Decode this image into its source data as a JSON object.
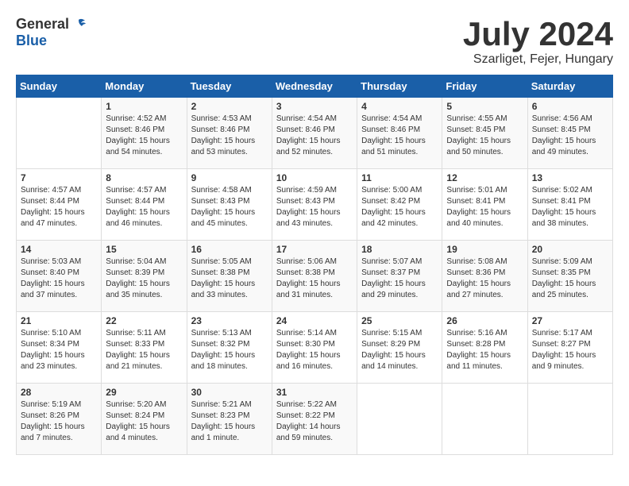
{
  "logo": {
    "general": "General",
    "blue": "Blue"
  },
  "title": {
    "month_year": "July 2024",
    "location": "Szarliget, Fejer, Hungary"
  },
  "days_of_week": [
    "Sunday",
    "Monday",
    "Tuesday",
    "Wednesday",
    "Thursday",
    "Friday",
    "Saturday"
  ],
  "weeks": [
    [
      {
        "day": "",
        "info": ""
      },
      {
        "day": "1",
        "info": "Sunrise: 4:52 AM\nSunset: 8:46 PM\nDaylight: 15 hours\nand 54 minutes."
      },
      {
        "day": "2",
        "info": "Sunrise: 4:53 AM\nSunset: 8:46 PM\nDaylight: 15 hours\nand 53 minutes."
      },
      {
        "day": "3",
        "info": "Sunrise: 4:54 AM\nSunset: 8:46 PM\nDaylight: 15 hours\nand 52 minutes."
      },
      {
        "day": "4",
        "info": "Sunrise: 4:54 AM\nSunset: 8:46 PM\nDaylight: 15 hours\nand 51 minutes."
      },
      {
        "day": "5",
        "info": "Sunrise: 4:55 AM\nSunset: 8:45 PM\nDaylight: 15 hours\nand 50 minutes."
      },
      {
        "day": "6",
        "info": "Sunrise: 4:56 AM\nSunset: 8:45 PM\nDaylight: 15 hours\nand 49 minutes."
      }
    ],
    [
      {
        "day": "7",
        "info": "Sunrise: 4:57 AM\nSunset: 8:44 PM\nDaylight: 15 hours\nand 47 minutes."
      },
      {
        "day": "8",
        "info": "Sunrise: 4:57 AM\nSunset: 8:44 PM\nDaylight: 15 hours\nand 46 minutes."
      },
      {
        "day": "9",
        "info": "Sunrise: 4:58 AM\nSunset: 8:43 PM\nDaylight: 15 hours\nand 45 minutes."
      },
      {
        "day": "10",
        "info": "Sunrise: 4:59 AM\nSunset: 8:43 PM\nDaylight: 15 hours\nand 43 minutes."
      },
      {
        "day": "11",
        "info": "Sunrise: 5:00 AM\nSunset: 8:42 PM\nDaylight: 15 hours\nand 42 minutes."
      },
      {
        "day": "12",
        "info": "Sunrise: 5:01 AM\nSunset: 8:41 PM\nDaylight: 15 hours\nand 40 minutes."
      },
      {
        "day": "13",
        "info": "Sunrise: 5:02 AM\nSunset: 8:41 PM\nDaylight: 15 hours\nand 38 minutes."
      }
    ],
    [
      {
        "day": "14",
        "info": "Sunrise: 5:03 AM\nSunset: 8:40 PM\nDaylight: 15 hours\nand 37 minutes."
      },
      {
        "day": "15",
        "info": "Sunrise: 5:04 AM\nSunset: 8:39 PM\nDaylight: 15 hours\nand 35 minutes."
      },
      {
        "day": "16",
        "info": "Sunrise: 5:05 AM\nSunset: 8:38 PM\nDaylight: 15 hours\nand 33 minutes."
      },
      {
        "day": "17",
        "info": "Sunrise: 5:06 AM\nSunset: 8:38 PM\nDaylight: 15 hours\nand 31 minutes."
      },
      {
        "day": "18",
        "info": "Sunrise: 5:07 AM\nSunset: 8:37 PM\nDaylight: 15 hours\nand 29 minutes."
      },
      {
        "day": "19",
        "info": "Sunrise: 5:08 AM\nSunset: 8:36 PM\nDaylight: 15 hours\nand 27 minutes."
      },
      {
        "day": "20",
        "info": "Sunrise: 5:09 AM\nSunset: 8:35 PM\nDaylight: 15 hours\nand 25 minutes."
      }
    ],
    [
      {
        "day": "21",
        "info": "Sunrise: 5:10 AM\nSunset: 8:34 PM\nDaylight: 15 hours\nand 23 minutes."
      },
      {
        "day": "22",
        "info": "Sunrise: 5:11 AM\nSunset: 8:33 PM\nDaylight: 15 hours\nand 21 minutes."
      },
      {
        "day": "23",
        "info": "Sunrise: 5:13 AM\nSunset: 8:32 PM\nDaylight: 15 hours\nand 18 minutes."
      },
      {
        "day": "24",
        "info": "Sunrise: 5:14 AM\nSunset: 8:30 PM\nDaylight: 15 hours\nand 16 minutes."
      },
      {
        "day": "25",
        "info": "Sunrise: 5:15 AM\nSunset: 8:29 PM\nDaylight: 15 hours\nand 14 minutes."
      },
      {
        "day": "26",
        "info": "Sunrise: 5:16 AM\nSunset: 8:28 PM\nDaylight: 15 hours\nand 11 minutes."
      },
      {
        "day": "27",
        "info": "Sunrise: 5:17 AM\nSunset: 8:27 PM\nDaylight: 15 hours\nand 9 minutes."
      }
    ],
    [
      {
        "day": "28",
        "info": "Sunrise: 5:19 AM\nSunset: 8:26 PM\nDaylight: 15 hours\nand 7 minutes."
      },
      {
        "day": "29",
        "info": "Sunrise: 5:20 AM\nSunset: 8:24 PM\nDaylight: 15 hours\nand 4 minutes."
      },
      {
        "day": "30",
        "info": "Sunrise: 5:21 AM\nSunset: 8:23 PM\nDaylight: 15 hours\nand 1 minute."
      },
      {
        "day": "31",
        "info": "Sunrise: 5:22 AM\nSunset: 8:22 PM\nDaylight: 14 hours\nand 59 minutes."
      },
      {
        "day": "",
        "info": ""
      },
      {
        "day": "",
        "info": ""
      },
      {
        "day": "",
        "info": ""
      }
    ]
  ]
}
